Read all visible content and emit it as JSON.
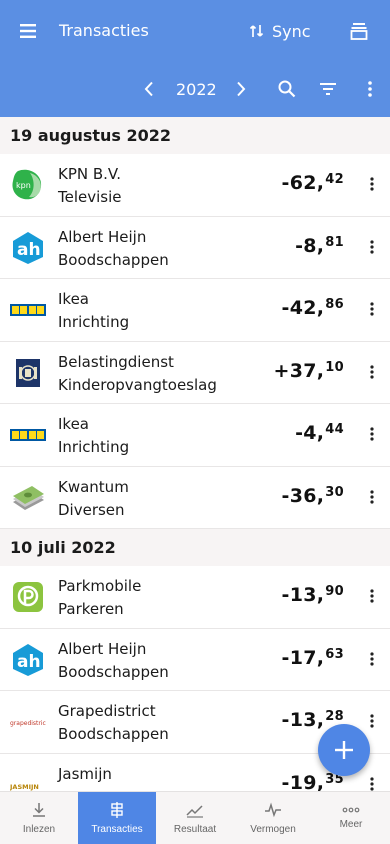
{
  "header": {
    "title": "Transacties",
    "sync_label": "Sync",
    "year": "2022"
  },
  "sections": [
    {
      "date": "19 augustus 2022",
      "items": [
        {
          "name": "KPN B.V.",
          "category": "Televisie",
          "amount_main": "-62,",
          "amount_cents": "42",
          "logo": "kpn-logo"
        },
        {
          "name": "Albert Heijn",
          "category": "Boodschappen",
          "amount_main": "-8,",
          "amount_cents": "81",
          "logo": "ah-logo"
        },
        {
          "name": "Ikea",
          "category": "Inrichting",
          "amount_main": "-42,",
          "amount_cents": "86",
          "logo": "ikea-logo"
        },
        {
          "name": "Belastingdienst",
          "category": "Kinderopvangtoeslag",
          "amount_main": "+37,",
          "amount_cents": "10",
          "logo": "belastingdienst-logo"
        },
        {
          "name": "Ikea",
          "category": "Inrichting",
          "amount_main": "-4,",
          "amount_cents": "44",
          "logo": "ikea-logo"
        },
        {
          "name": "Kwantum",
          "category": "Diversen",
          "amount_main": "-36,",
          "amount_cents": "30",
          "logo": "money-icon"
        }
      ]
    },
    {
      "date": "10 juli 2022",
      "items": [
        {
          "name": "Parkmobile",
          "category": "Parkeren",
          "amount_main": "-13,",
          "amount_cents": "90",
          "logo": "parkmobile-logo"
        },
        {
          "name": "Albert Heijn",
          "category": "Boodschappen",
          "amount_main": "-17,",
          "amount_cents": "63",
          "logo": "ah-logo"
        },
        {
          "name": "Grapedistrict",
          "category": "Boodschappen",
          "amount_main": "-13,",
          "amount_cents": "28",
          "logo": "grapedistrict-logo",
          "logo_text": "grapedistrict"
        },
        {
          "name": "Jasmijn",
          "category": "",
          "amount_main": "-19,",
          "amount_cents": "35",
          "logo": "jasmijn-logo",
          "logo_text": "JASMIJN"
        }
      ]
    }
  ],
  "bottom_nav": [
    {
      "label": "Inlezen",
      "icon": "download-icon",
      "active": false
    },
    {
      "label": "Transacties",
      "icon": "transactions-icon",
      "active": true
    },
    {
      "label": "Resultaat",
      "icon": "chart-icon",
      "active": false
    },
    {
      "label": "Vermogen",
      "icon": "pulse-icon",
      "active": false
    },
    {
      "label": "Meer",
      "icon": "more-horizontal-icon",
      "active": false
    }
  ],
  "colors": {
    "primary": "#5b8fe3",
    "fab": "#4f86e5",
    "section_bg": "#f7f4f4"
  }
}
